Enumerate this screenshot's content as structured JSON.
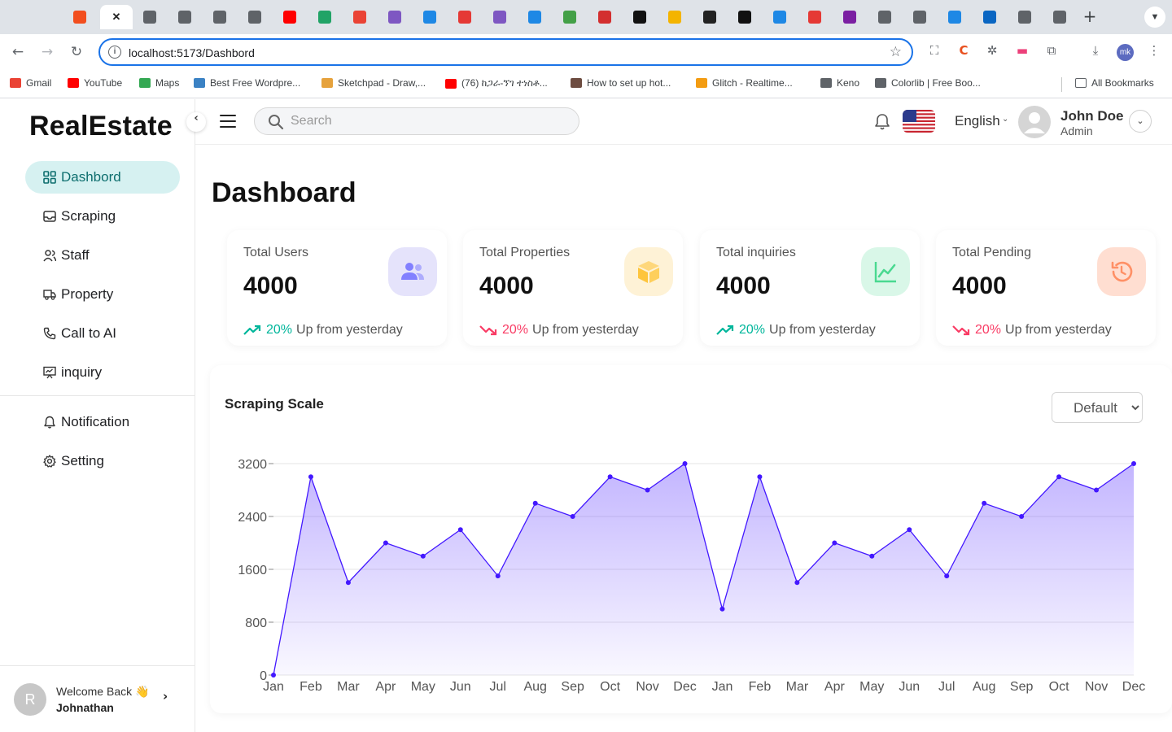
{
  "browser": {
    "url": "localhost:5173/Dashbord",
    "profile_initials": "mk",
    "bookmarks": [
      {
        "label": "Gmail",
        "color": "#ea4335"
      },
      {
        "label": "YouTube",
        "color": "#ff0000"
      },
      {
        "label": "Maps",
        "color": "#34a853"
      },
      {
        "label": "Best Free Wordpre...",
        "color": "#3b82c4"
      },
      {
        "label": "Sketchpad - Draw,...",
        "color": "#e6a23c"
      },
      {
        "label": "(76) ከጋራ-ኘገ ተነስቶ...",
        "color": "#ff0000"
      },
      {
        "label": "How to set up hot...",
        "color": "#6d4c41"
      },
      {
        "label": "Glitch - Realtime...",
        "color": "#f39c12"
      },
      {
        "label": "Keno",
        "color": "#5f6368"
      },
      {
        "label": "Colorlib | Free Boo...",
        "color": "#5f6368"
      }
    ],
    "all_bookmarks_label": "All Bookmarks"
  },
  "app": {
    "brand": "RealEstate",
    "nav": [
      {
        "label": "Dashbord",
        "icon": "grid-icon",
        "active": true
      },
      {
        "label": "Scraping",
        "icon": "inbox-icon"
      },
      {
        "label": "Staff",
        "icon": "users-icon"
      },
      {
        "label": "Property",
        "icon": "truck-icon"
      },
      {
        "label": "Call to AI",
        "icon": "phone-icon"
      },
      {
        "label": "inquiry",
        "icon": "presentation-icon"
      }
    ],
    "nav_secondary": [
      {
        "label": "Notification",
        "icon": "bell-icon"
      },
      {
        "label": "Setting",
        "icon": "gear-icon"
      }
    ],
    "welcome": {
      "avatar_letter": "R",
      "greeting": "Welcome Back 👋",
      "name": "Johnathan"
    }
  },
  "header": {
    "search_placeholder": "Search",
    "language": "English",
    "user_name": "John Doe",
    "user_role": "Admin"
  },
  "page": {
    "title": "Dashboard"
  },
  "stats": [
    {
      "label": "Total Users",
      "value": "4000",
      "trend": "up",
      "percent": "20%",
      "note": "Up from yesterday",
      "icon": "users-icon",
      "icon_bg": "#e5e3fb",
      "icon_color": "#8280ff"
    },
    {
      "label": "Total Properties",
      "value": "4000",
      "trend": "down",
      "percent": "20%",
      "note": "Up from yesterday",
      "icon": "box-icon",
      "icon_bg": "#fef2d6",
      "icon_color": "#fec53d"
    },
    {
      "label": "Total inquiries",
      "value": "4000",
      "trend": "up",
      "percent": "20%",
      "note": "Up from yesterday",
      "icon": "chart-line-icon",
      "icon_bg": "#d9f7e8",
      "icon_color": "#4ad991"
    },
    {
      "label": "Total Pending",
      "value": "4000",
      "trend": "down",
      "percent": "20%",
      "note": "Up from yesterday",
      "icon": "history-icon",
      "icon_bg": "#ffded1",
      "icon_color": "#ff9066"
    }
  ],
  "colors": {
    "up": "#00b69b",
    "down": "#f93c65",
    "accent": "#4318ff",
    "active_nav_bg": "#d6f1f1"
  },
  "chart_section": {
    "title": "Scraping Scale",
    "select_value": "Default"
  },
  "chart_data": {
    "type": "area",
    "title": "Scraping Scale",
    "categories": [
      "Jan",
      "Feb",
      "Mar",
      "Apr",
      "May",
      "Jun",
      "Jul",
      "Aug",
      "Sep",
      "Oct",
      "Nov",
      "Dec",
      "Jan",
      "Feb",
      "Mar",
      "Apr",
      "May",
      "Jun",
      "Jul",
      "Aug",
      "Sep",
      "Oct",
      "Nov",
      "Dec"
    ],
    "values": [
      0,
      3000,
      1400,
      2000,
      1800,
      2200,
      1500,
      2600,
      2400,
      3000,
      2800,
      3200,
      1000,
      3000,
      1400,
      2000,
      1800,
      2200,
      1500,
      2600,
      2400,
      3000,
      2800,
      3200
    ],
    "ylim": [
      0,
      3200
    ],
    "yticks": [
      0,
      800,
      1600,
      2400,
      3200
    ],
    "grid": true,
    "legend": "none",
    "line_color": "#4318ff"
  }
}
